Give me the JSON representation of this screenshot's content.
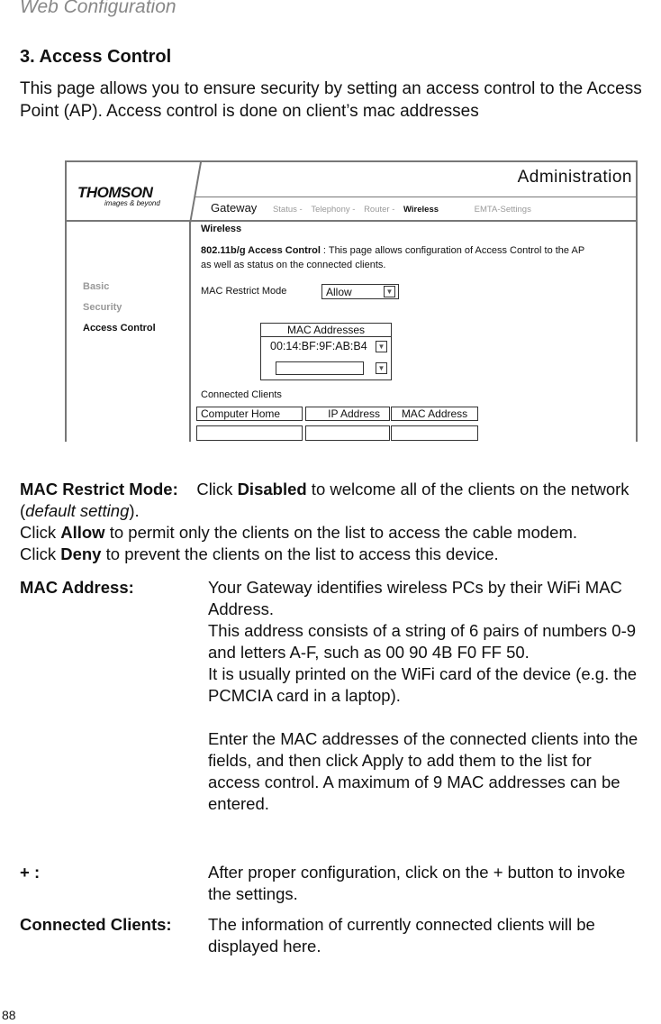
{
  "header": "Web Configuration",
  "section_title": "3. Access Control",
  "intro": "This page allows you to ensure security by setting an access control to the Access Point (AP). Access control is done on client’s mac addresses",
  "screenshot": {
    "logo": "THOMSON",
    "logo_tagline": "images & beyond",
    "title": "Administration",
    "nav": {
      "gateway": "Gateway",
      "items": [
        "Status -",
        "Telephony -",
        "Router -",
        "Wireless",
        "EMTA-Settings"
      ],
      "active": "Wireless"
    },
    "sidebar": [
      "Basic",
      "Security",
      "Access Control"
    ],
    "sidebar_active": "Access Control",
    "heading": "Wireless",
    "desc_bold": "802.11b/g Access Control",
    "desc": " : This page allows configuration of Access Control to the AP as well as status on the connected clients.",
    "mac_restrict_label": "MAC Restrict Mode",
    "mac_restrict_value": "Allow",
    "mac_addresses_header": "MAC Addresses",
    "mac_address_1": "00:14:BF:9F:AB:B4",
    "mac_address_2": "",
    "connected_clients": "Connected Clients",
    "columns": [
      "Computer Home",
      "IP Address",
      "MAC Address"
    ]
  },
  "defs": {
    "mrm_label": "MAC Restrict Mode:",
    "mrm_1": "Click ",
    "mrm_disabled": "Disabled",
    "mrm_2": " to welcome all of the clients on the network (",
    "mrm_default": "default setting",
    "mrm_3": ").",
    "allow_1": "Click ",
    "allow": "Allow",
    "allow_2": " to permit only the clients on the list to access the cable modem.",
    "deny_1": "Click ",
    "deny": "Deny",
    "deny_2": " to prevent the clients on the list to access this device.",
    "mac_label": "MAC Address:",
    "mac_p1": "Your Gateway identifies wireless PCs by their WiFi MAC Address.",
    "mac_p2": "This address consists of a string of 6 pairs of numbers 0-9 and letters A-F, such as 00 90 4B F0 FF 50.",
    "mac_p3": "It is usually printed on the WiFi card of the device (e.g. the PCMCIA card in a laptop).",
    "mac_p4": "Enter the MAC addresses of the connected clients into the fields, and then click Apply to add them to the list for access control. A maximum of 9 MAC addresses can be entered.",
    "plus_label": "+ :",
    "plus_text": "After proper configuration, click on the + button to invoke the settings.",
    "cc_label": "Connected Clients:",
    "cc_text": "The information of currently connected clients will be displayed here."
  },
  "page_number": "88"
}
